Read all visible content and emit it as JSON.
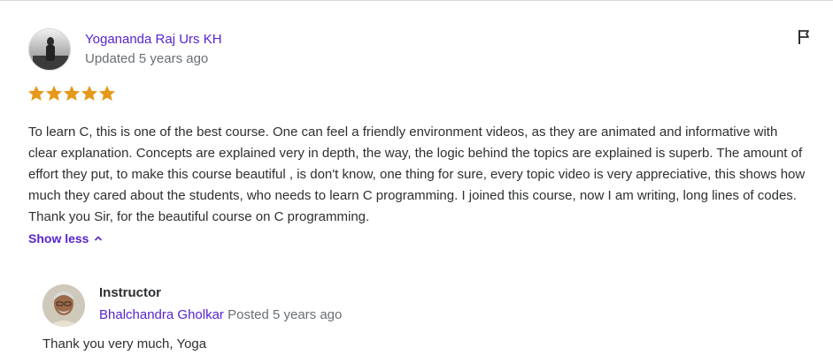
{
  "review": {
    "reviewer_name": "Yogananda Raj Urs KH",
    "updated": "Updated 5 years ago",
    "rating": 5,
    "rating_max": 5,
    "text": "To learn C, this is one of the best course. One can feel a friendly environment videos, as they are animated and informative with clear explanation. Concepts are explained very in depth, the way, the logic behind the topics are explained is superb. The amount of effort they put, to make this course beautiful , is don't know, one thing for sure, every topic video is very appreciative, this shows how much they cared about the students, who needs to learn C programming. I joined this course, now I am writing, long lines of codes. Thank you Sir, for the beautiful course on C programming.",
    "show_less_label": "Show less",
    "flag_icon": "flag-icon",
    "star_icon": "star-icon"
  },
  "response": {
    "label": "Instructor",
    "name": "Bhalchandra Gholkar",
    "posted": "Posted 5 years ago",
    "text": "Thank you very much, Yoga"
  },
  "colors": {
    "accent": "#5624d0",
    "star": "#e59819",
    "muted_text": "#6a6f73",
    "body_text": "#2d2f31",
    "divider": "#d1d7dc"
  }
}
